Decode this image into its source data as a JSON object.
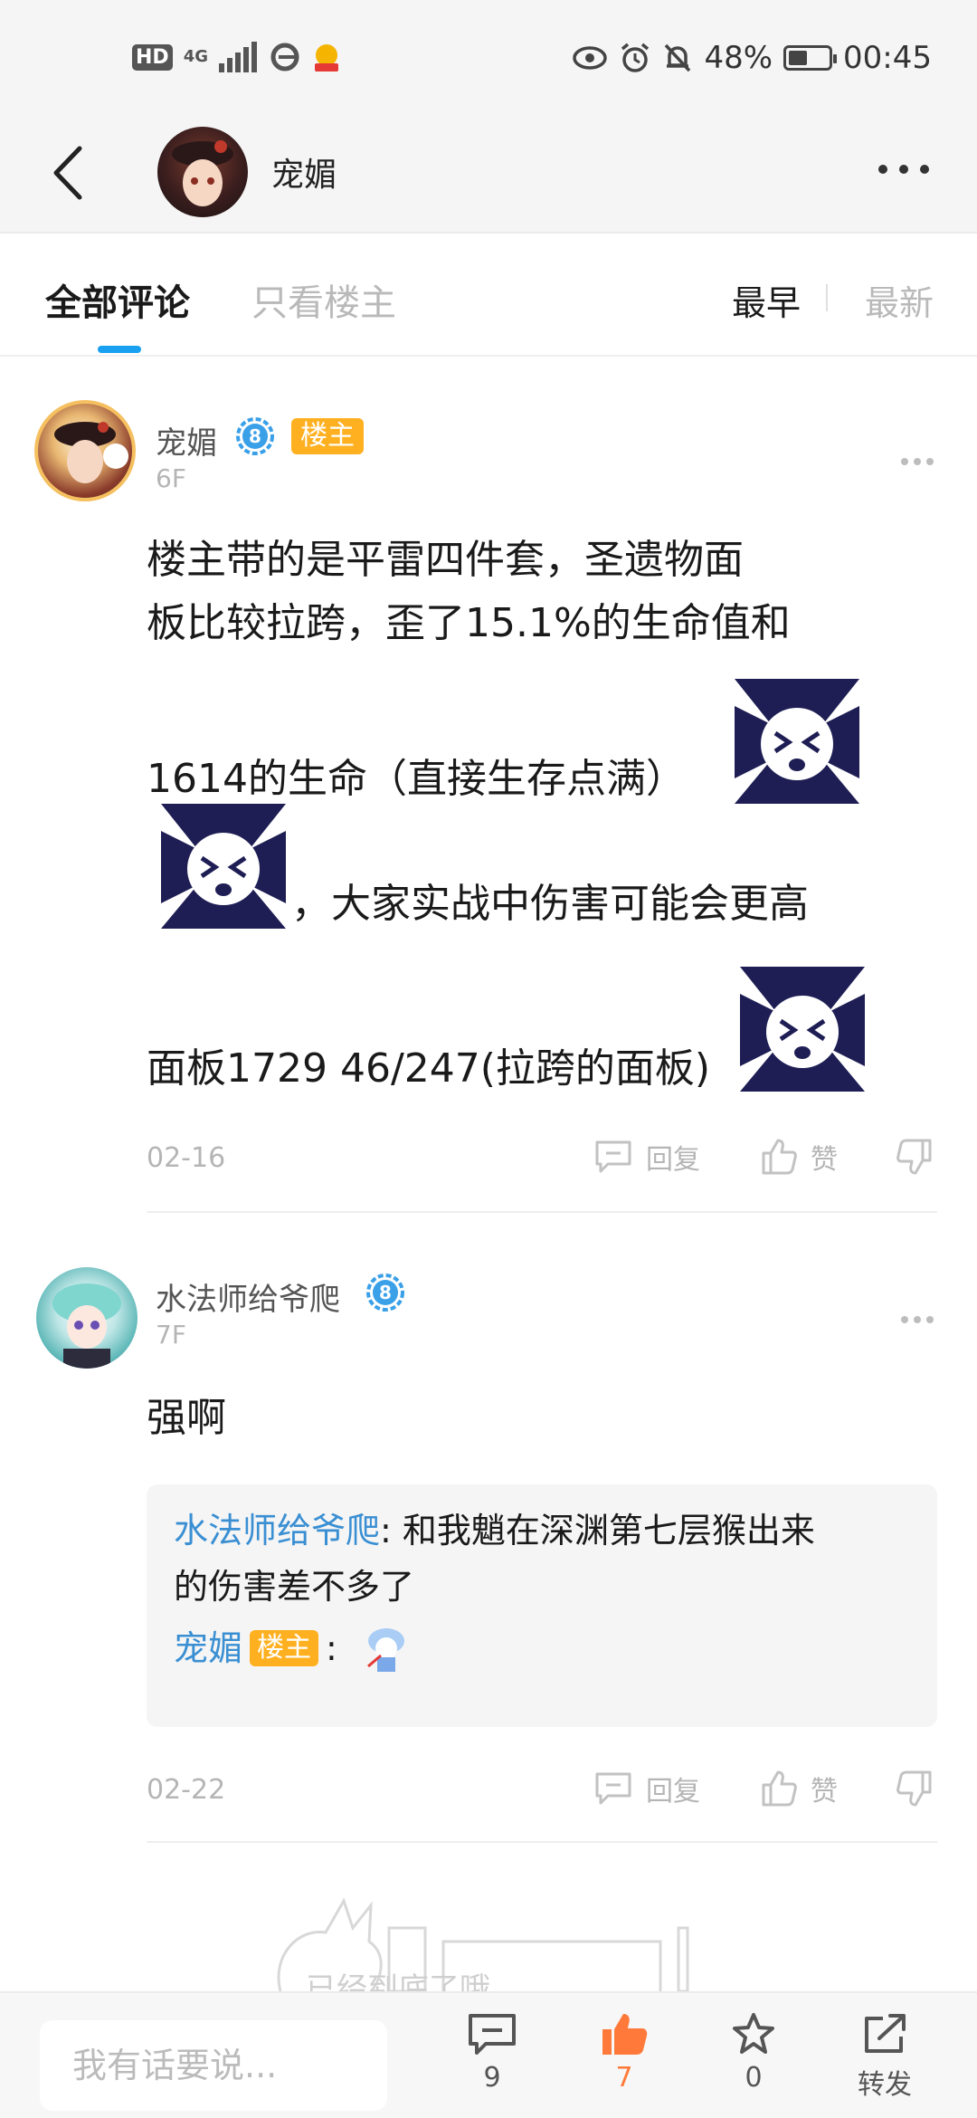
{
  "status_bar": {
    "network": "4G",
    "hd": "HD",
    "battery_text": "48%",
    "battery_level": 0.48,
    "time": "00:45"
  },
  "header": {
    "title": "宠媚"
  },
  "tabs": {
    "all": "全部评论",
    "owner_only": "只看楼主",
    "sort_earliest": "最早",
    "sort_latest": "最新"
  },
  "comments": [
    {
      "user": "宠媚",
      "level": "8",
      "badge": "楼主",
      "floor": "6F",
      "lines": [
        "楼主带的是平雷四件套，圣遗物面",
        "板比较拉跨，歪了15.1%的生命值和",
        "1614的生命（直接生存点满）",
        "，大家实战中伤害可能会更高",
        "面板1729 46/247(拉跨的面板)"
      ],
      "date": "02-16",
      "reply_label": "回复",
      "like_label": "赞"
    },
    {
      "user": "水法师给爷爬",
      "level": "8",
      "floor": "7F",
      "text": "强啊",
      "reply": {
        "user": "水法师给爷爬",
        "text_line1": ": 和我魈在深渊第七层猴出来",
        "text_line2": "的伤害差不多了",
        "reply_user": "宠媚",
        "reply_badge": "楼主",
        "colon": ":"
      },
      "date": "02-22",
      "reply_label": "回复",
      "like_label": "赞"
    }
  ],
  "end_note": "已经到底了哦",
  "bottom_bar": {
    "input_placeholder": "我有话要说...",
    "comment_count": "9",
    "like_count": "7",
    "favorite_count": "0",
    "share_label": "转发"
  },
  "colors": {
    "accent_blue": "#19a0f0",
    "owner_badge": "#ffb020",
    "like_active": "#ff7a3a",
    "reply_user": "#3a8fd3"
  }
}
